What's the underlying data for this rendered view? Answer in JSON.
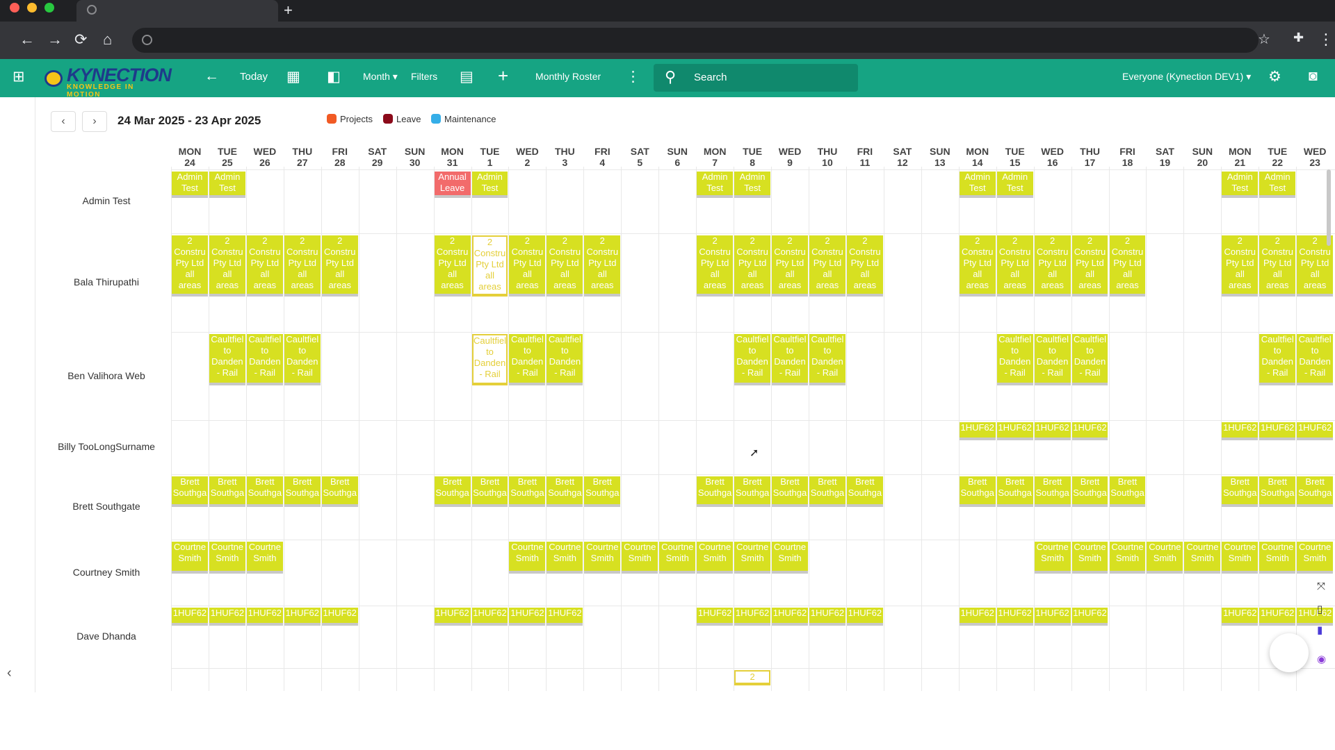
{
  "browser": {
    "newtab_glyph": "+",
    "nav_back": "←",
    "nav_forward": "→",
    "nav_reload": "⟳",
    "nav_home": "⌂",
    "star": "☆",
    "extensions": "✚",
    "menu": "⋮"
  },
  "toolbar": {
    "logo_text": "KYNECTION",
    "logo_tagline": "KNOWLEDGE IN MOTION",
    "apps_icon": "⊞",
    "back_icon": "←",
    "today_label": "Today",
    "calendar_icon": "▦",
    "map_icon": "◧",
    "view_label": "Month ▾",
    "filters_label": "Filters",
    "roster_icon": "▤",
    "add_icon": "+",
    "roster_label": "Monthly Roster",
    "more_icon": "⋮",
    "search_icon": "⚲",
    "search_placeholder": "Search",
    "workspace_label": "Everyone (Kynection DEV1) ▾",
    "settings_icon": "⚙",
    "account_icon": "◙"
  },
  "calendar": {
    "prev": "‹",
    "next": "›",
    "date_range": "24 Mar 2025 - 23 Apr 2025",
    "legend": [
      {
        "label": "Projects",
        "color": "#f15a24"
      },
      {
        "label": "Leave",
        "color": "#8b0a1a"
      },
      {
        "label": "Maintenance",
        "color": "#35aee8"
      }
    ],
    "days": [
      {
        "dow": "MON",
        "d": "24"
      },
      {
        "dow": "TUE",
        "d": "25"
      },
      {
        "dow": "WED",
        "d": "26"
      },
      {
        "dow": "THU",
        "d": "27"
      },
      {
        "dow": "FRI",
        "d": "28"
      },
      {
        "dow": "SAT",
        "d": "29"
      },
      {
        "dow": "SUN",
        "d": "30"
      },
      {
        "dow": "MON",
        "d": "31"
      },
      {
        "dow": "TUE",
        "d": "1"
      },
      {
        "dow": "WED",
        "d": "2"
      },
      {
        "dow": "THU",
        "d": "3"
      },
      {
        "dow": "FRI",
        "d": "4"
      },
      {
        "dow": "SAT",
        "d": "5"
      },
      {
        "dow": "SUN",
        "d": "6"
      },
      {
        "dow": "MON",
        "d": "7"
      },
      {
        "dow": "TUE",
        "d": "8"
      },
      {
        "dow": "WED",
        "d": "9"
      },
      {
        "dow": "THU",
        "d": "10"
      },
      {
        "dow": "FRI",
        "d": "11"
      },
      {
        "dow": "SAT",
        "d": "12"
      },
      {
        "dow": "SUN",
        "d": "13"
      },
      {
        "dow": "MON",
        "d": "14"
      },
      {
        "dow": "TUE",
        "d": "15"
      },
      {
        "dow": "WED",
        "d": "16"
      },
      {
        "dow": "THU",
        "d": "17"
      },
      {
        "dow": "FRI",
        "d": "18"
      },
      {
        "dow": "SAT",
        "d": "19"
      },
      {
        "dow": "SUN",
        "d": "20"
      },
      {
        "dow": "MON",
        "d": "21"
      },
      {
        "dow": "TUE",
        "d": "22"
      },
      {
        "dow": "WED",
        "d": "23"
      }
    ],
    "employees": [
      {
        "name": "Admin Test"
      },
      {
        "name": "Bala Thirupathi"
      },
      {
        "name": "Ben Valihora Web"
      },
      {
        "name": "Billy TooLongSurname"
      },
      {
        "name": "Brett Southgate"
      },
      {
        "name": "Courtney Smith"
      },
      {
        "name": "Dave Dhanda"
      }
    ],
    "event_types": {
      "admin": [
        "Admin",
        "Test"
      ],
      "leave": [
        "Annual",
        "Leave"
      ],
      "constr": [
        "2",
        "Constru",
        "Pty Ltd",
        "all",
        "areas"
      ],
      "caul": [
        "Caultfiel",
        "to",
        "Danden",
        "- Rail"
      ],
      "huf": [
        "1HUF62"
      ],
      "brett": [
        "Brett",
        "Southga"
      ],
      "court": [
        "Courtne",
        "Smith"
      ],
      "two": [
        "2"
      ]
    },
    "events": [
      {
        "row": 0,
        "days": [
          0,
          1
        ],
        "type": "admin"
      },
      {
        "row": 0,
        "days": [
          7
        ],
        "type": "leave"
      },
      {
        "row": 0,
        "days": [
          8
        ],
        "type": "admin"
      },
      {
        "row": 0,
        "days": [
          14,
          15
        ],
        "type": "admin"
      },
      {
        "row": 0,
        "days": [
          21,
          22
        ],
        "type": "admin"
      },
      {
        "row": 0,
        "days": [
          28,
          29
        ],
        "type": "admin"
      },
      {
        "row": 1,
        "days": [
          0,
          1,
          2,
          3,
          4,
          7,
          9,
          10,
          11,
          14,
          15,
          16,
          17,
          18,
          21,
          22,
          23,
          24,
          25,
          28,
          29,
          30
        ],
        "type": "constr"
      },
      {
        "row": 1,
        "days": [
          8
        ],
        "type": "constr",
        "selected": true
      },
      {
        "row": 2,
        "days": [
          1,
          2,
          3,
          9,
          10,
          15,
          16,
          17,
          22,
          23,
          24,
          29,
          30
        ],
        "type": "caul"
      },
      {
        "row": 2,
        "days": [
          8
        ],
        "type": "caul",
        "selected": true
      },
      {
        "row": 3,
        "days": [
          21,
          22,
          23,
          24,
          28,
          29,
          30
        ],
        "type": "huf"
      },
      {
        "row": 4,
        "days": [
          0,
          1,
          2,
          3,
          4,
          7,
          8,
          9,
          10,
          11,
          14,
          15,
          16,
          17,
          18,
          21,
          22,
          23,
          24,
          25,
          28,
          29,
          30
        ],
        "type": "brett"
      },
      {
        "row": 5,
        "days": [
          0,
          1,
          2,
          9,
          10,
          11,
          12,
          13,
          14,
          15,
          16,
          23,
          24,
          25,
          26,
          27,
          28,
          29,
          30
        ],
        "type": "court"
      },
      {
        "row": 6,
        "days": [
          0,
          1,
          2,
          3,
          4,
          7,
          8,
          9,
          10,
          14,
          15,
          16,
          17,
          18,
          21,
          22,
          23,
          24,
          28,
          29,
          30
        ],
        "type": "huf"
      },
      {
        "row": 7,
        "days": [
          15
        ],
        "type": "two",
        "selected": true
      }
    ]
  },
  "side_icons": [
    "⤧",
    "▯",
    "▮",
    "◉"
  ],
  "collapse_icon": "‹"
}
